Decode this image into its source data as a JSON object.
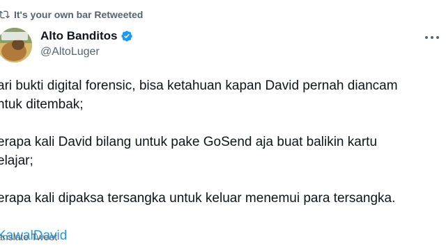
{
  "retweet": {
    "label": "It's your own bar Retweeted",
    "icon": "retweet-icon"
  },
  "author": {
    "display_name": "Alto Banditos",
    "handle": "@AltoLuger",
    "verified": true,
    "verified_color": "#1d9bf0"
  },
  "tweet": {
    "paragraphs": [
      [
        "ari bukti digital forensic, bisa ketahuan kapan David pernah diancam",
        "ntuk ditembak;"
      ],
      [
        "erapa kali David bilang untuk pake GoSend aja buat balikin kartu",
        "elajar;"
      ],
      [
        "erapa kali dipaksa tersangka untuk keluar menemui para tersangka."
      ]
    ],
    "hashtag": "KawalDavid",
    "hashtag_color": "#1d9bf0"
  },
  "translate_label": "anslate Tweet"
}
